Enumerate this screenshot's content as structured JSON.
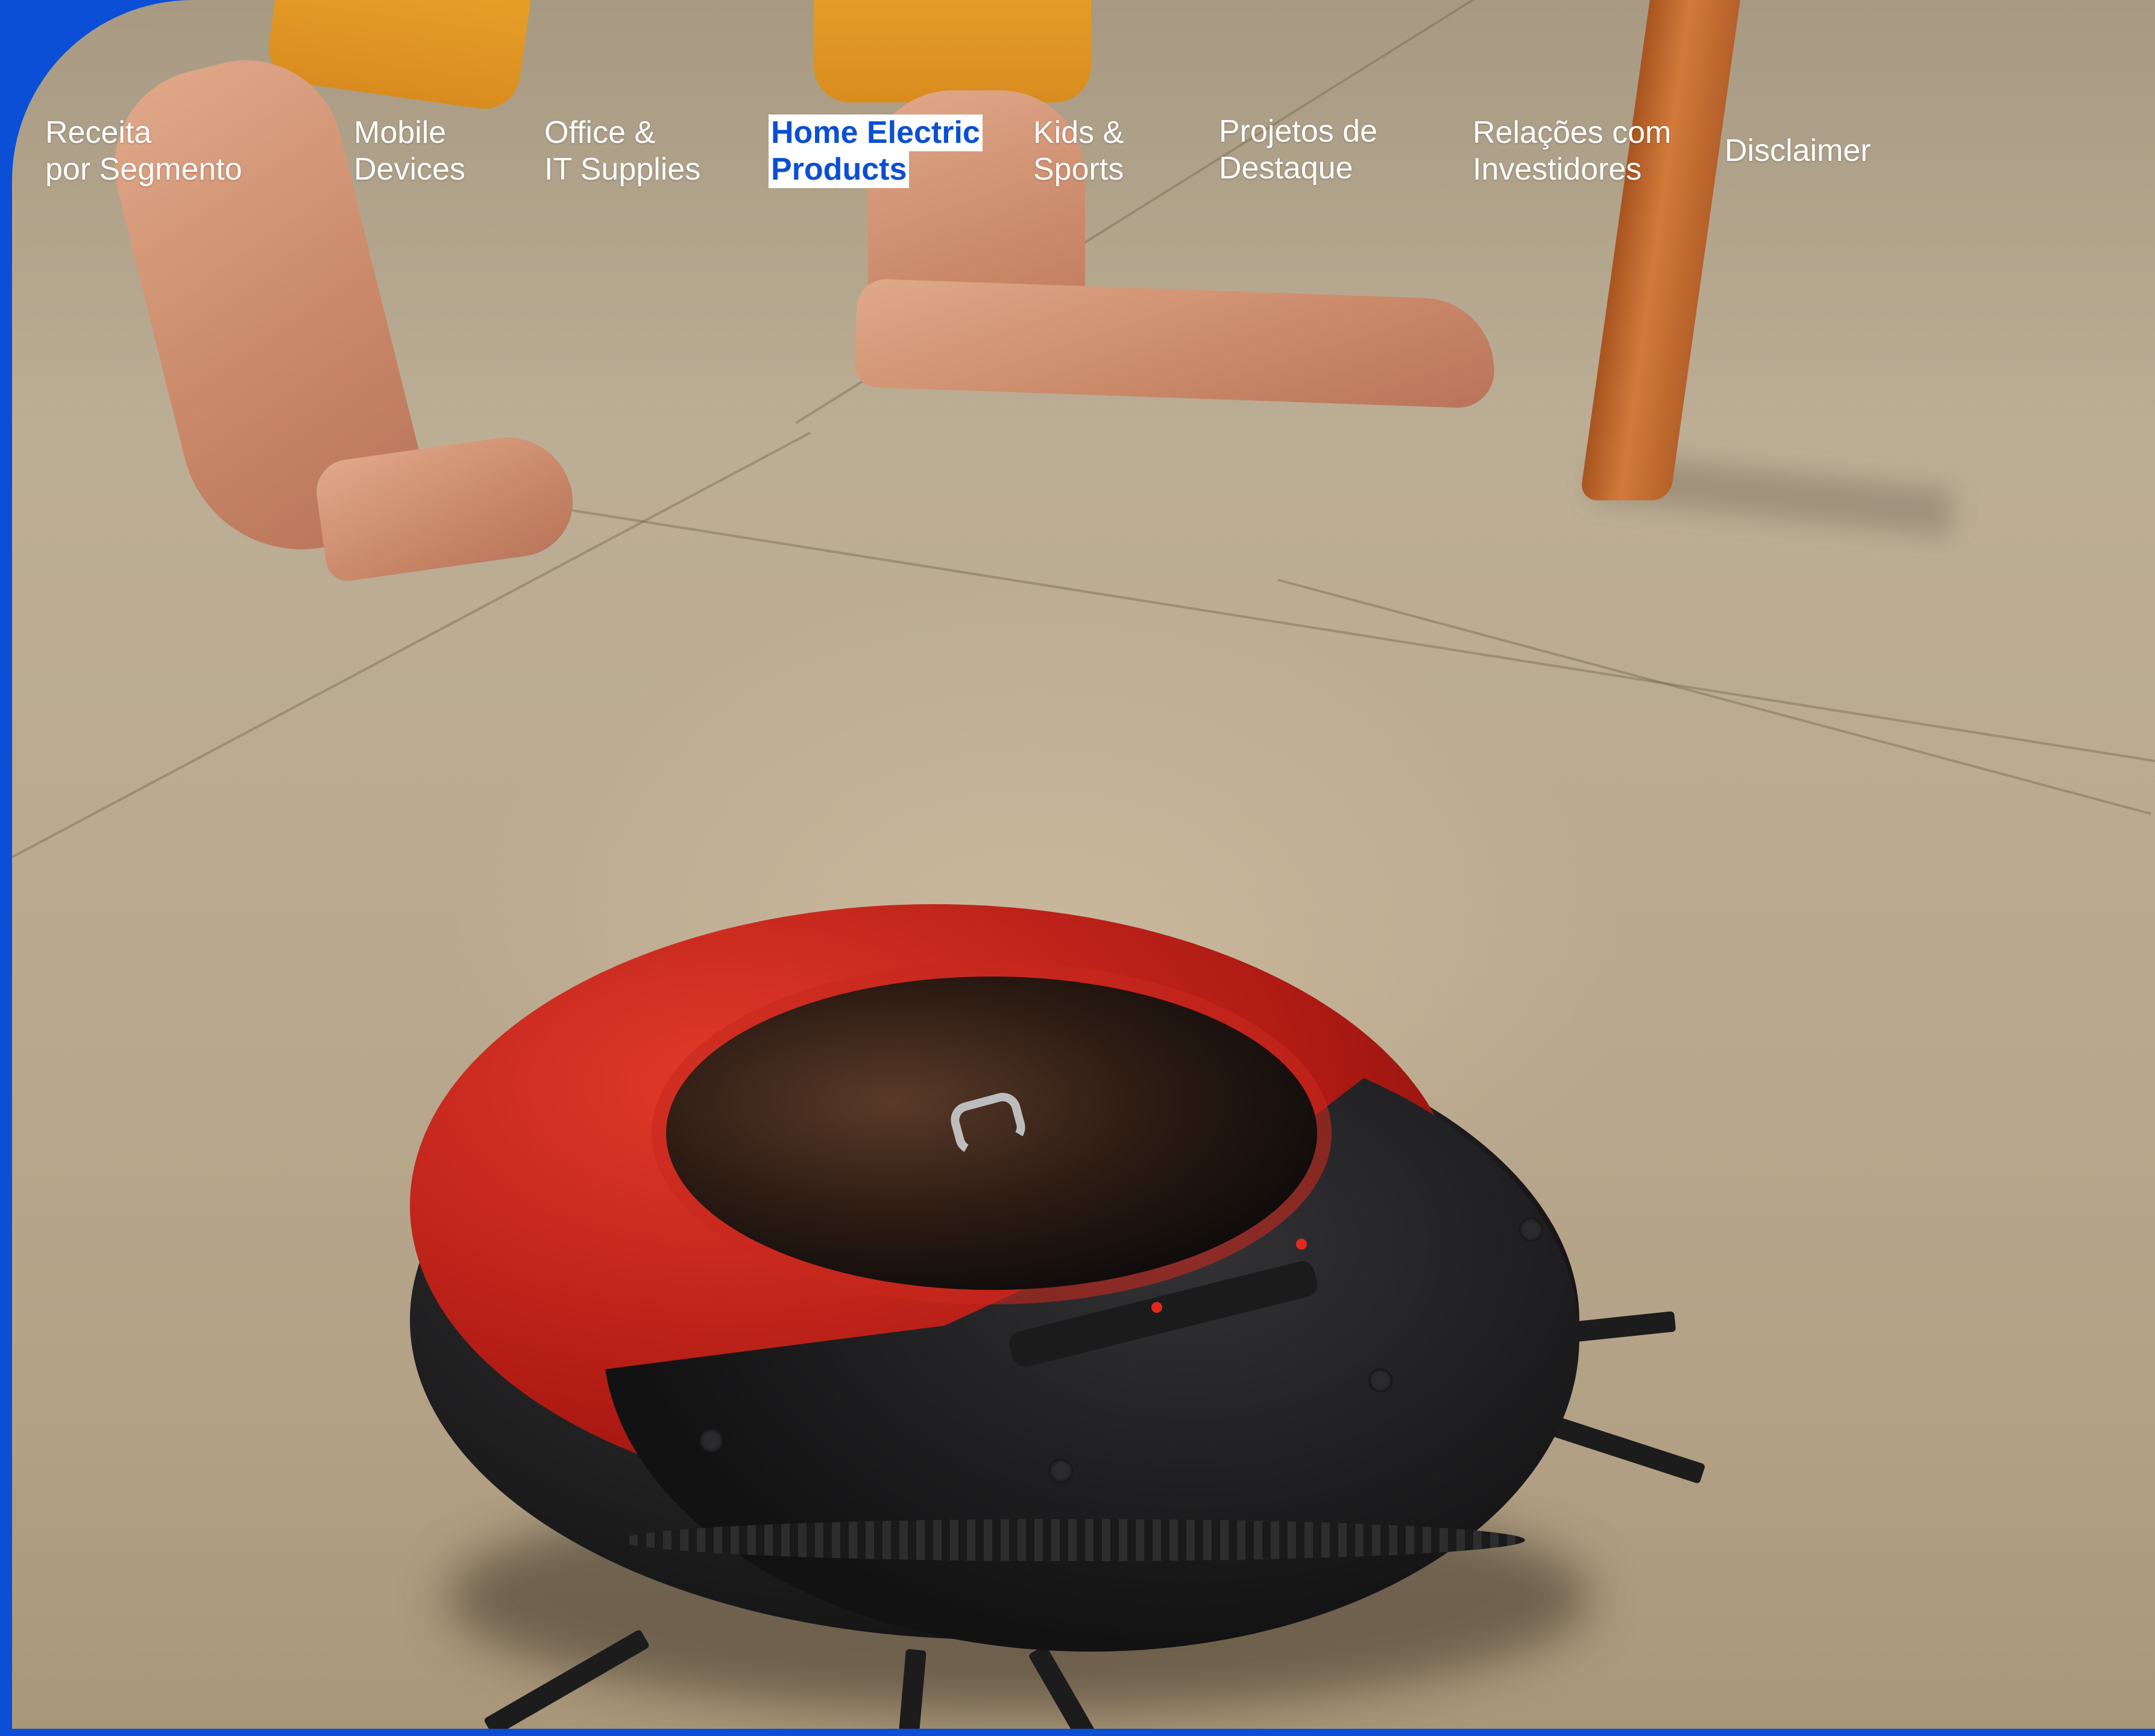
{
  "nav": {
    "items": [
      {
        "line1": "Receita",
        "line2": "por Segmento",
        "active": false
      },
      {
        "line1": "Mobile",
        "line2": "Devices",
        "active": false
      },
      {
        "line1": "Office &",
        "line2": "IT Supplies",
        "active": false
      },
      {
        "line1": "Home Electric",
        "line2": "Products",
        "active": true
      },
      {
        "line1": "Kids &",
        "line2": "Sports",
        "active": false
      },
      {
        "line1": "Projetos de",
        "line2": "Destaque",
        "active": false
      },
      {
        "line1": "Relações com",
        "line2": "Investidores",
        "active": false
      },
      {
        "line1": "Disclaimer",
        "line2": "",
        "active": false
      }
    ]
  },
  "colors": {
    "brand_blue": "#0a4fd6",
    "nav_text": "#ffffff",
    "active_text": "#0b4fd4",
    "active_bg": "#ffffff",
    "robot_red": "#c0211a",
    "robot_black": "#161617"
  },
  "hero": {
    "image_subject": "robot-vacuum-on-tile-floor"
  }
}
